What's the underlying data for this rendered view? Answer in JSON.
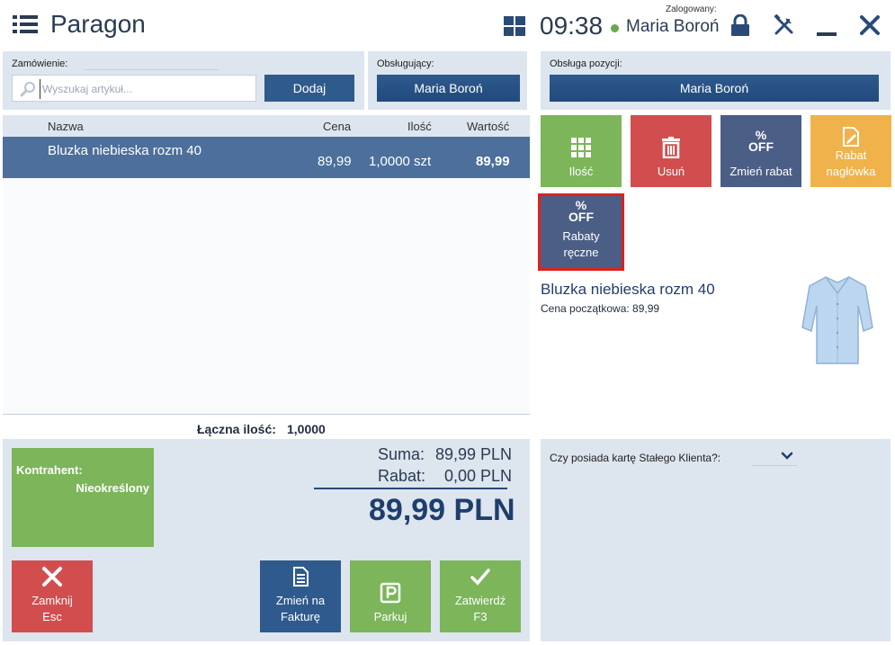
{
  "header": {
    "title": "Paragon",
    "time": "09:38",
    "logged_label": "Zalogowany:",
    "user": "Maria Boroń"
  },
  "order": {
    "label": "Zamówienie:",
    "search_placeholder": "Wyszukaj artykuł...",
    "add_label": "Dodaj"
  },
  "waiter": {
    "label": "Obsługujący:",
    "name": "Maria Boroń"
  },
  "position_service": {
    "label": "Obsługa pozycji:",
    "name": "Maria Boroń"
  },
  "table": {
    "columns": {
      "name": "Nazwa",
      "price": "Cena",
      "qty": "Ilość",
      "value": "Wartość"
    },
    "rows": [
      {
        "name": "Bluzka niebieska rozm 40",
        "price": "89,99",
        "qty": "1,0000 szt",
        "value": "89,99"
      }
    ]
  },
  "totals": {
    "qty_label": "Łączna ilość:",
    "qty_value": "1,0000",
    "sum_label": "Suma:",
    "sum_value": "89,99 PLN",
    "discount_label": "Rabat:",
    "discount_value": "0,00 PLN",
    "grand_total": "89,99 PLN"
  },
  "contractor": {
    "label": "Kontrahent:",
    "value": "Nieokreślony"
  },
  "actions": {
    "close_line1": "Zamknij",
    "close_line2": "Esc",
    "invoice_line1": "Zmień na",
    "invoice_line2": "Fakturę",
    "park": "Parkuj",
    "confirm_line1": "Zatwierdź",
    "confirm_line2": "F3"
  },
  "functions": {
    "qty": "Ilość",
    "delete": "Usuń",
    "change_discount": "Zmień rabat",
    "header_discount_line1": "Rabat",
    "header_discount_line2": "nagłówka",
    "manual_discounts_line1": "Rabaty",
    "manual_discounts_line2": "ręczne",
    "off_percent": "%",
    "off_text": "OFF"
  },
  "product": {
    "name": "Bluzka niebieska rozm 40",
    "initial_price": "Cena początkowa: 89,99"
  },
  "loyalty": {
    "question": "Czy posiada kartę Stałego Klienta?:"
  },
  "icons": {
    "menu": "hamburger-icon",
    "grid": "grid-icon",
    "lock": "lock-icon",
    "tools": "tools-icon",
    "minimize": "minimize-icon",
    "close": "close-icon"
  },
  "colors": {
    "primary_blue": "#2e5a8e",
    "selected_row": "#4c6f9b",
    "green": "#7cb55a",
    "red": "#d24e4e",
    "slate": "#4b5e85",
    "orange": "#f0b24a",
    "panel_bg": "#dde5ee",
    "highlight": "#e0201c"
  }
}
